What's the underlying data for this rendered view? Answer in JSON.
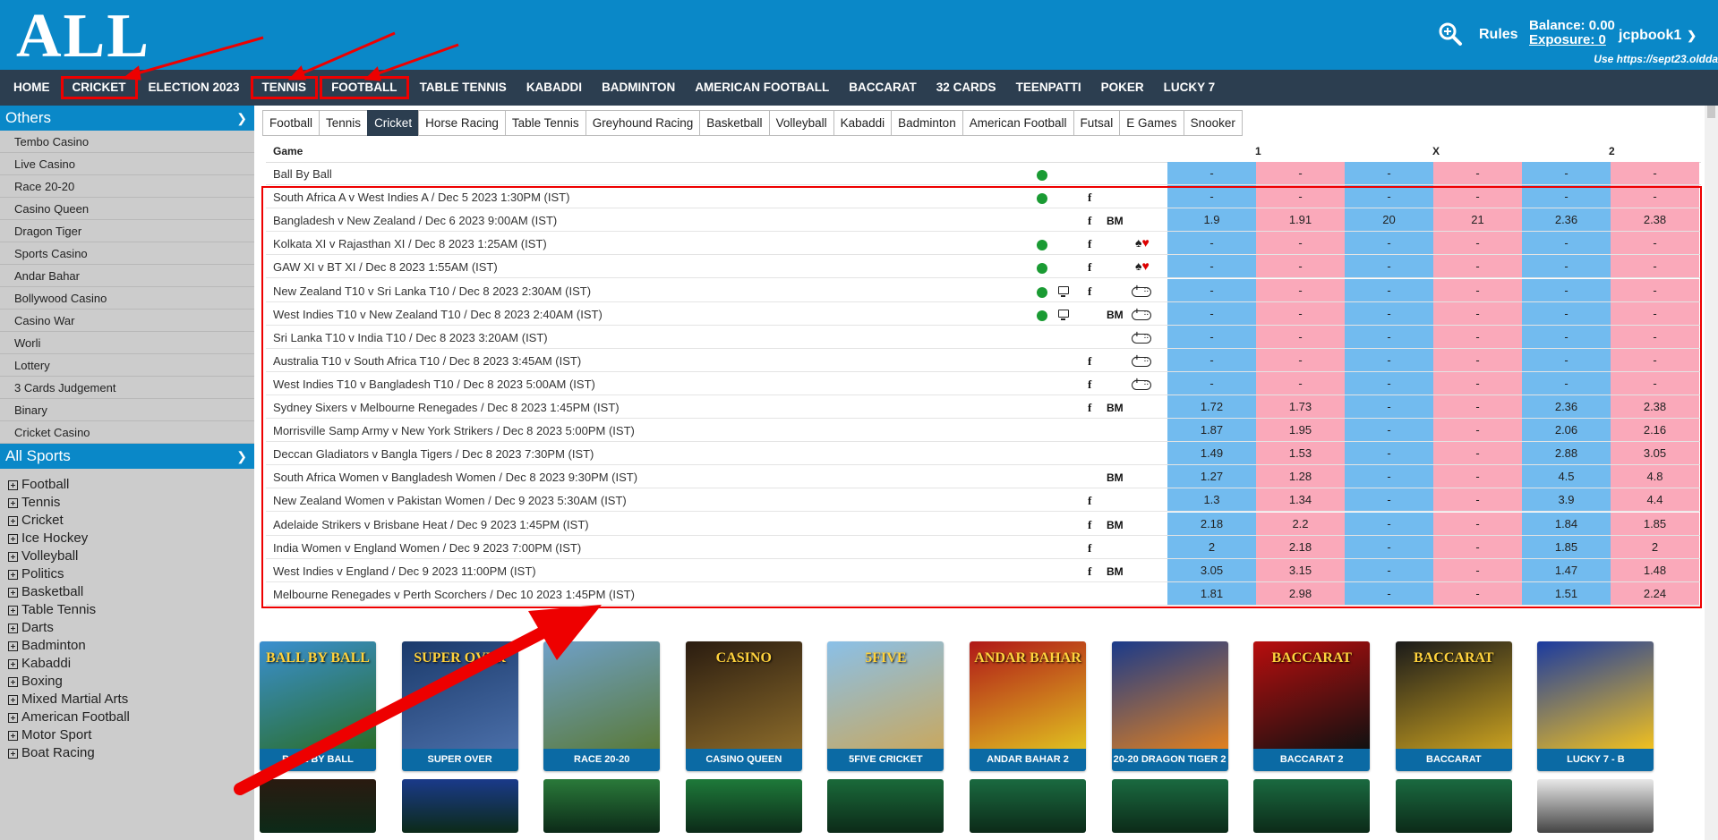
{
  "header": {
    "logo": "ALL",
    "rules_label": "Rules",
    "balance_label": "Balance:",
    "balance_value": "0.00",
    "exposure_label": "Exposure:",
    "exposure_value": "0",
    "username": "jcpbook1",
    "site_note": "Use https://sept23.oldda"
  },
  "main_nav": [
    "HOME",
    "CRICKET",
    "ELECTION 2023",
    "TENNIS",
    "FOOTBALL",
    "TABLE TENNIS",
    "KABADDI",
    "BADMINTON",
    "AMERICAN FOOTBALL",
    "BACCARAT",
    "32 CARDS",
    "TEENPATTI",
    "POKER",
    "LUCKY 7"
  ],
  "main_nav_highlighted": [
    "CRICKET",
    "TENNIS",
    "FOOTBALL"
  ],
  "sidebar": {
    "others_title": "Others",
    "others": [
      "Tembo Casino",
      "Live Casino",
      "Race 20-20",
      "Casino Queen",
      "Dragon Tiger",
      "Sports Casino",
      "Andar Bahar",
      "Bollywood Casino",
      "Casino War",
      "Worli",
      "Lottery",
      "3 Cards Judgement",
      "Binary",
      "Cricket Casino"
    ],
    "all_sports_title": "All Sports",
    "sports": [
      "Football",
      "Tennis",
      "Cricket",
      "Ice Hockey",
      "Volleyball",
      "Politics",
      "Basketball",
      "Table Tennis",
      "Darts",
      "Badminton",
      "Kabaddi",
      "Boxing",
      "Mixed Martial Arts",
      "American Football",
      "Motor Sport",
      "Boat Racing"
    ]
  },
  "sport_tabs": [
    "Football",
    "Tennis",
    "Cricket",
    "Horse Racing",
    "Table Tennis",
    "Greyhound Racing",
    "Basketball",
    "Volleyball",
    "Kabaddi",
    "Badminton",
    "American Football",
    "Futsal",
    "E Games",
    "Snooker"
  ],
  "active_tab": "Cricket",
  "table": {
    "col_game": "Game",
    "col_1": "1",
    "col_x": "X",
    "col_2": "2",
    "rows": [
      {
        "name": "Ball By Ball",
        "live": true,
        "tv": false,
        "fb": false,
        "bm": false,
        "icon": "",
        "odds": [
          "-",
          "-",
          "-",
          "-",
          "-",
          "-"
        ]
      },
      {
        "name": "South Africa A v West Indies A / Dec 5 2023 1:30PM (IST)",
        "live": true,
        "tv": false,
        "fb": true,
        "bm": false,
        "icon": "",
        "odds": [
          "-",
          "-",
          "-",
          "-",
          "-",
          "-"
        ]
      },
      {
        "name": "Bangladesh v New Zealand / Dec 6 2023 9:00AM (IST)",
        "live": false,
        "tv": false,
        "fb": true,
        "bm": true,
        "icon": "",
        "odds": [
          "1.9",
          "1.91",
          "20",
          "21",
          "2.36",
          "2.38"
        ]
      },
      {
        "name": "Kolkata XI v Rajasthan XI / Dec 8 2023 1:25AM (IST)",
        "live": true,
        "tv": false,
        "fb": true,
        "bm": false,
        "icon": "cards",
        "odds": [
          "-",
          "-",
          "-",
          "-",
          "-",
          "-"
        ]
      },
      {
        "name": "GAW XI v BT XI / Dec 8 2023 1:55AM (IST)",
        "live": true,
        "tv": false,
        "fb": true,
        "bm": false,
        "icon": "cards",
        "odds": [
          "-",
          "-",
          "-",
          "-",
          "-",
          "-"
        ]
      },
      {
        "name": "New Zealand T10 v Sri Lanka T10 / Dec 8 2023 2:30AM (IST)",
        "live": true,
        "tv": true,
        "fb": true,
        "bm": false,
        "icon": "gamepad",
        "odds": [
          "-",
          "-",
          "-",
          "-",
          "-",
          "-"
        ]
      },
      {
        "name": "West Indies T10 v New Zealand T10 / Dec 8 2023 2:40AM (IST)",
        "live": true,
        "tv": true,
        "fb": false,
        "bm": true,
        "icon": "gamepad",
        "odds": [
          "-",
          "-",
          "-",
          "-",
          "-",
          "-"
        ]
      },
      {
        "name": "Sri Lanka T10 v India T10 / Dec 8 2023 3:20AM (IST)",
        "live": false,
        "tv": false,
        "fb": false,
        "bm": false,
        "icon": "gamepad",
        "odds": [
          "-",
          "-",
          "-",
          "-",
          "-",
          "-"
        ]
      },
      {
        "name": "Australia T10 v South Africa T10 / Dec 8 2023 3:45AM (IST)",
        "live": false,
        "tv": false,
        "fb": true,
        "bm": false,
        "icon": "gamepad",
        "odds": [
          "-",
          "-",
          "-",
          "-",
          "-",
          "-"
        ]
      },
      {
        "name": "West Indies T10 v Bangladesh T10 / Dec 8 2023 5:00AM (IST)",
        "live": false,
        "tv": false,
        "fb": true,
        "bm": false,
        "icon": "gamepad",
        "odds": [
          "-",
          "-",
          "-",
          "-",
          "-",
          "-"
        ]
      },
      {
        "name": "Sydney Sixers v Melbourne Renegades / Dec 8 2023 1:45PM (IST)",
        "live": false,
        "tv": false,
        "fb": true,
        "bm": true,
        "icon": "",
        "odds": [
          "1.72",
          "1.73",
          "-",
          "-",
          "2.36",
          "2.38"
        ]
      },
      {
        "name": "Morrisville Samp Army v New York Strikers / Dec 8 2023 5:00PM (IST)",
        "live": false,
        "tv": false,
        "fb": false,
        "bm": false,
        "icon": "",
        "odds": [
          "1.87",
          "1.95",
          "-",
          "-",
          "2.06",
          "2.16"
        ]
      },
      {
        "name": "Deccan Gladiators v Bangla Tigers / Dec 8 2023 7:30PM (IST)",
        "live": false,
        "tv": false,
        "fb": false,
        "bm": false,
        "icon": "",
        "odds": [
          "1.49",
          "1.53",
          "-",
          "-",
          "2.88",
          "3.05"
        ]
      },
      {
        "name": "South Africa Women v Bangladesh Women / Dec 8 2023 9:30PM (IST)",
        "live": false,
        "tv": false,
        "fb": false,
        "bm": true,
        "icon": "",
        "odds": [
          "1.27",
          "1.28",
          "-",
          "-",
          "4.5",
          "4.8"
        ]
      },
      {
        "name": "New Zealand Women v Pakistan Women / Dec 9 2023 5:30AM (IST)",
        "live": false,
        "tv": false,
        "fb": true,
        "bm": false,
        "icon": "",
        "odds": [
          "1.3",
          "1.34",
          "-",
          "-",
          "3.9",
          "4.4"
        ]
      },
      {
        "name": "Adelaide Strikers v Brisbane Heat / Dec 9 2023 1:45PM (IST)",
        "live": false,
        "tv": false,
        "fb": true,
        "bm": true,
        "icon": "",
        "odds": [
          "2.18",
          "2.2",
          "-",
          "-",
          "1.84",
          "1.85"
        ]
      },
      {
        "name": "India Women v England Women / Dec 9 2023 7:00PM (IST)",
        "live": false,
        "tv": false,
        "fb": true,
        "bm": false,
        "icon": "",
        "odds": [
          "2",
          "2.18",
          "-",
          "-",
          "1.85",
          "2"
        ]
      },
      {
        "name": "West Indies v England / Dec 9 2023 11:00PM (IST)",
        "live": false,
        "tv": false,
        "fb": true,
        "bm": true,
        "icon": "",
        "odds": [
          "3.05",
          "3.15",
          "-",
          "-",
          "1.47",
          "1.48"
        ]
      },
      {
        "name": "Melbourne Renegades v Perth Scorchers / Dec 10 2023 1:45PM (IST)",
        "live": false,
        "tv": false,
        "fb": false,
        "bm": false,
        "icon": "",
        "odds": [
          "1.81",
          "2.98",
          "-",
          "-",
          "1.51",
          "2.24"
        ]
      }
    ]
  },
  "casino_tiles": [
    {
      "caption": "BALL BY BALL",
      "title": "BALL BY BALL",
      "bg": "#3a8fd0",
      "fg": "#2a6e2a"
    },
    {
      "caption": "SUPER OVER",
      "title": "SUPER OVER",
      "bg": "#1b3a6b",
      "fg": "#4a6ea8"
    },
    {
      "caption": "RACE 20-20",
      "title": "",
      "bg": "#6fa0c8",
      "fg": "#5a7a3a"
    },
    {
      "caption": "CASINO QUEEN",
      "title": "CASINO",
      "bg": "#2a1c10",
      "fg": "#8a6a2a"
    },
    {
      "caption": "5FIVE CRICKET",
      "title": "5FIVE",
      "bg": "#8ac0e8",
      "fg": "#c8a860"
    },
    {
      "caption": "ANDAR BAHAR 2",
      "title": "ANDAR BAHAR",
      "bg": "#b01818",
      "fg": "#e0c020"
    },
    {
      "caption": "20-20 DRAGON TIGER 2",
      "title": "",
      "bg": "#1a3a8a",
      "fg": "#e08020"
    },
    {
      "caption": "BACCARAT 2",
      "title": "BACCARAT",
      "bg": "#b80e0e",
      "fg": "#111111"
    },
    {
      "caption": "BACCARAT",
      "title": "BACCARAT",
      "bg": "#1a1a1a",
      "fg": "#c8a020"
    },
    {
      "caption": "LUCKY 7 - B",
      "title": "",
      "bg": "#1a3aa0",
      "fg": "#f0c020"
    }
  ],
  "casino_tiles_row2_colors": [
    "#2a1a10",
    "#1a3a8a",
    "#2a7a3a",
    "#1e7a3a",
    "#1a6a3a",
    "#1a6a40",
    "#1a6a40",
    "#1a6a40",
    "#1a6a40",
    "#e8e8e8"
  ],
  "colors": {
    "header": "#0a88c8",
    "nav": "#2c3e50",
    "back": "#72bbef",
    "lay": "#faa9ba",
    "annotation": "#ee0000"
  }
}
